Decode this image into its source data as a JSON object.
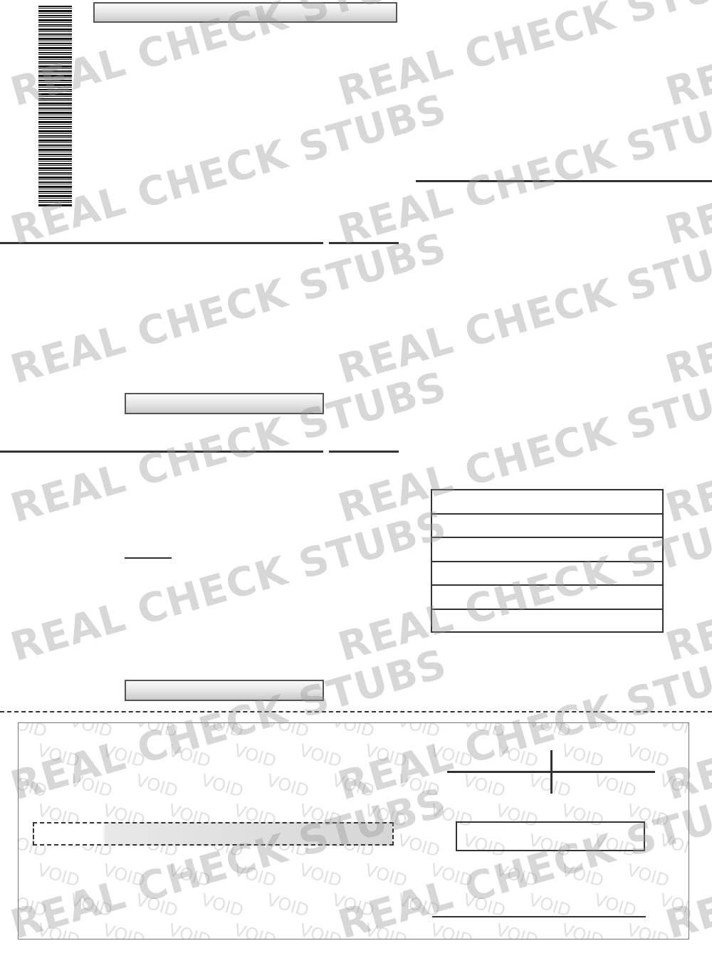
{
  "watermark": {
    "text": "REAL CHECK STUBS",
    "color": "#969696"
  },
  "check": {
    "void_text": "VOID"
  },
  "icons": {
    "barcode": "barcode-icon"
  },
  "colors": {
    "border": "#333333",
    "bar_top": "#fafafa",
    "bar_bottom": "#c9c9c9"
  }
}
